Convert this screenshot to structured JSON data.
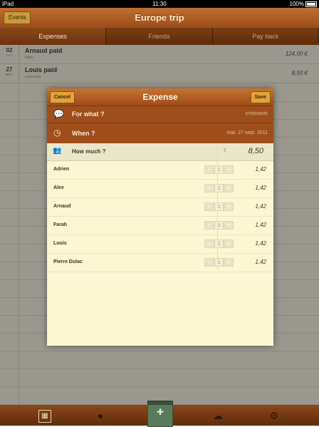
{
  "status": {
    "device": "iPad",
    "time": "11:30",
    "battery": "100%"
  },
  "header": {
    "title": "Europe trip",
    "events_label": "Events"
  },
  "tabs": [
    {
      "label": "Expenses"
    },
    {
      "label": "Friends"
    },
    {
      "label": "Pay back"
    }
  ],
  "expenses": [
    {
      "day": "02",
      "month": "OCT.",
      "title": "Arnaud  paid",
      "subtitle": "bikes",
      "amount": "124,00 €"
    },
    {
      "day": "27",
      "month": "SEPT.",
      "title": "Louis  paid",
      "subtitle": "croissants",
      "amount": "8,50 €"
    }
  ],
  "modal": {
    "title": "Expense",
    "cancel_label": "Cancel",
    "save_label": "Save",
    "for_what": {
      "label": "For what ?",
      "value": "croissants"
    },
    "when": {
      "label": "When ?",
      "value": "mar. 27 sept. 2011"
    },
    "how_much": {
      "label": "How much ?",
      "currency": "€",
      "amount": "8,50"
    },
    "people": [
      {
        "name": "Adrien",
        "count": "1",
        "share": "1,42"
      },
      {
        "name": "Alex",
        "count": "1",
        "share": "1,42"
      },
      {
        "name": "Arnaud",
        "count": "1",
        "share": "1,42"
      },
      {
        "name": "Farah",
        "count": "1",
        "share": "1,42"
      },
      {
        "name": "Louis",
        "count": "1",
        "share": "1,42"
      },
      {
        "name": "Pierre Dulac",
        "count": "1",
        "share": "1,42"
      }
    ],
    "stepper_minus": "−",
    "stepper_plus": "+"
  },
  "colors": {
    "accent": "#9f4e1b",
    "paper": "#fcf6d2"
  },
  "icons": {
    "toolbar": [
      "calendar-icon",
      "people-icon",
      "tab-book-icon",
      "cloud-icon",
      "gear-icon"
    ]
  }
}
